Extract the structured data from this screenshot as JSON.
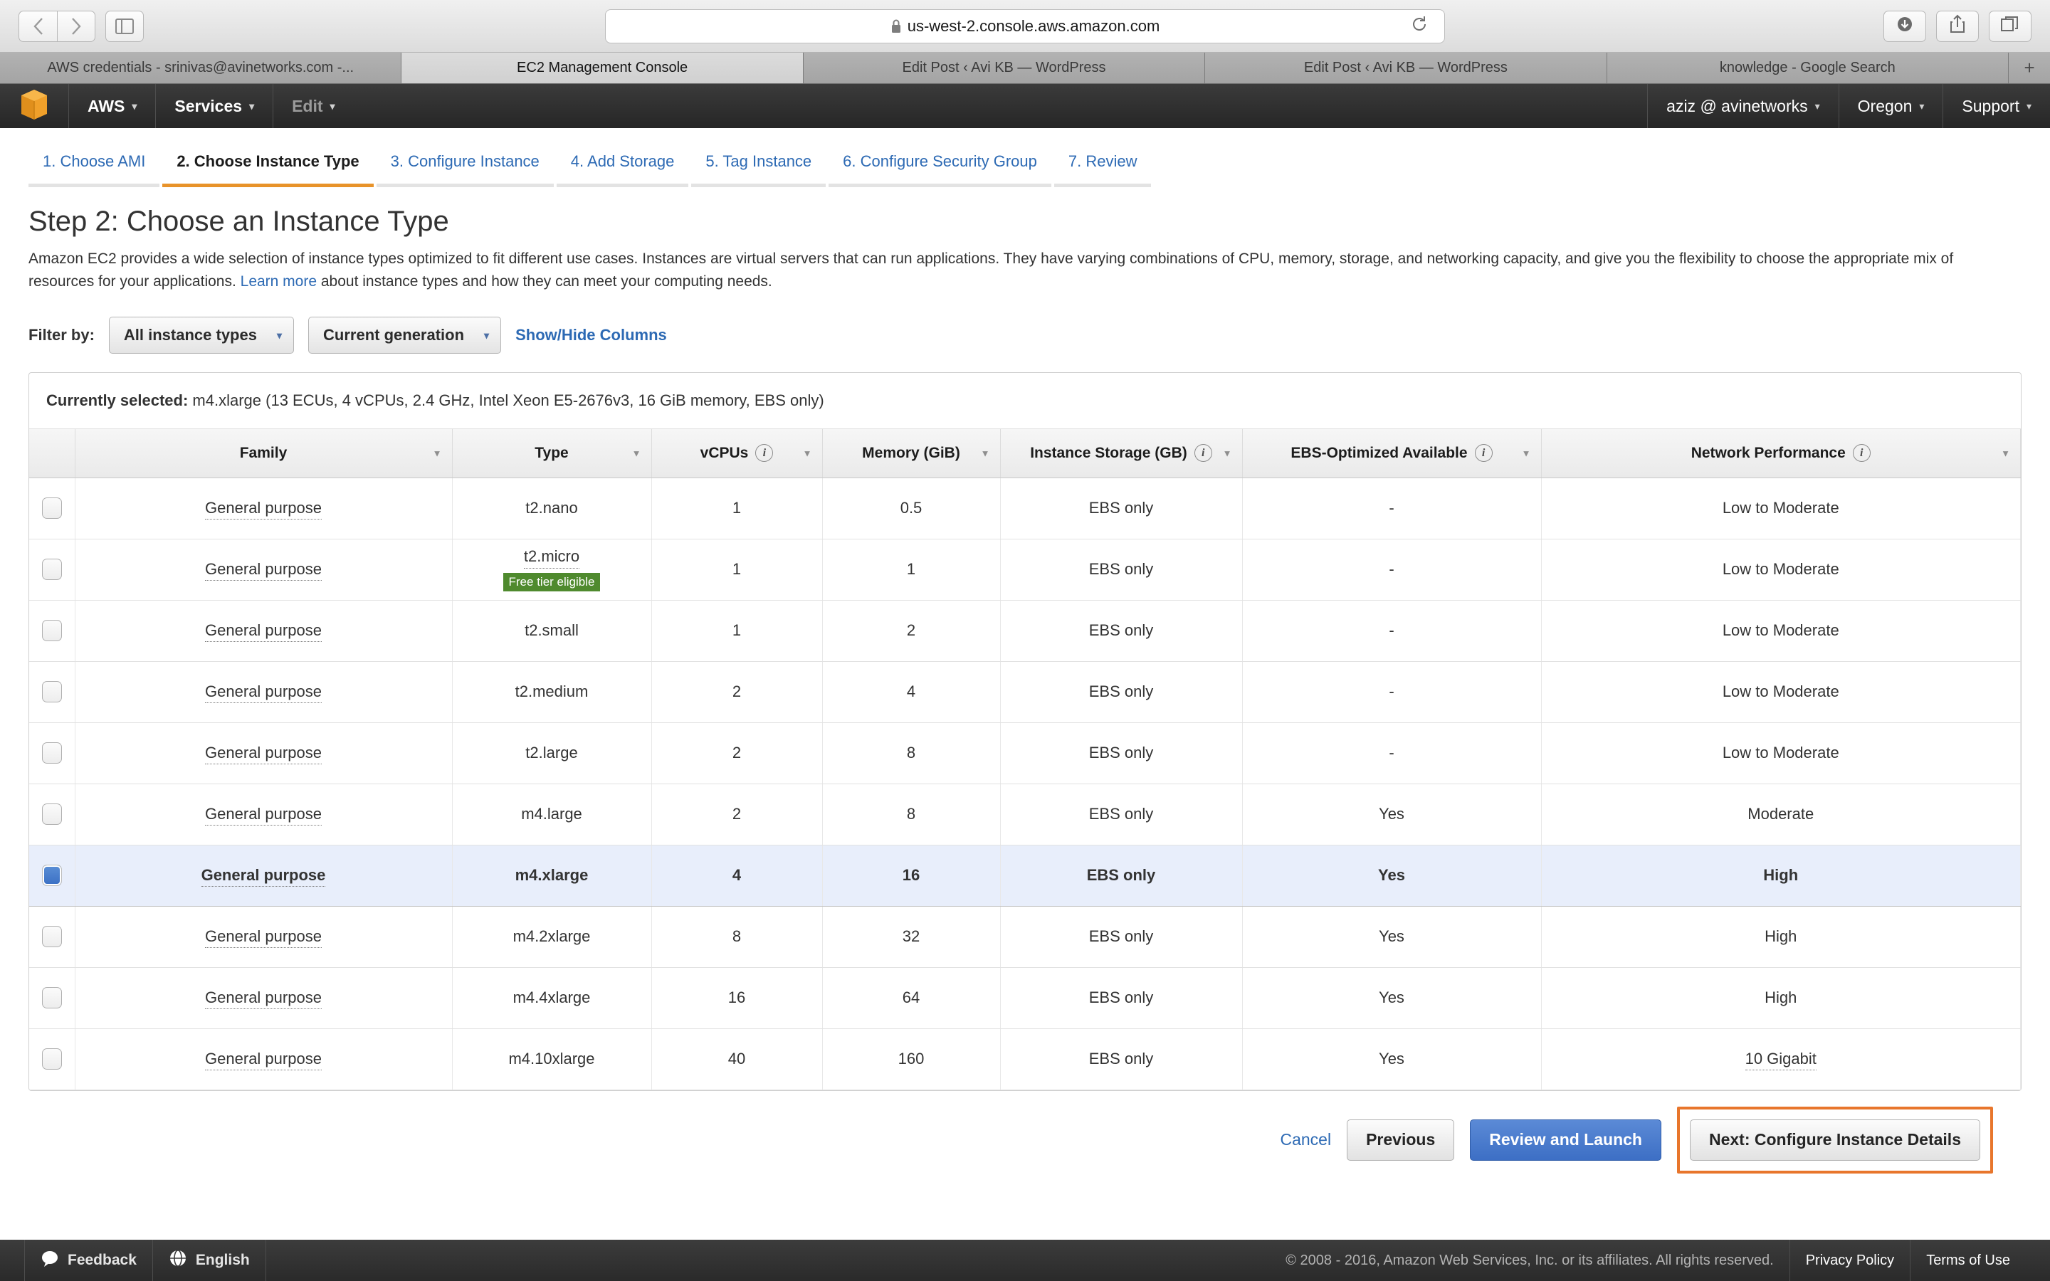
{
  "browser": {
    "url": "us-west-2.console.aws.amazon.com",
    "back_icon": "back-arrow-icon",
    "forward_icon": "forward-arrow-icon",
    "sidebar_icon": "sidebar-toggle-icon",
    "reload_icon": "reload-icon",
    "lock_icon": "lock-icon",
    "download_icon": "download-icon",
    "share_icon": "share-icon",
    "tabs_overview_icon": "tab-overview-icon",
    "new_tab_label": "+",
    "tabs": [
      {
        "label": "AWS credentials - srinivas@avinetworks.com -...",
        "active": false
      },
      {
        "label": "EC2 Management Console",
        "active": true
      },
      {
        "label": "Edit Post ‹ Avi KB — WordPress",
        "active": false
      },
      {
        "label": "Edit Post ‹ Avi KB — WordPress",
        "active": false
      },
      {
        "label": "knowledge - Google Search",
        "active": false
      }
    ]
  },
  "aws_nav": {
    "logo_icon": "aws-cube-logo-icon",
    "left_items": [
      {
        "label": "AWS",
        "caret": "▾",
        "dim": false
      },
      {
        "label": "Services",
        "caret": "▾",
        "dim": false
      },
      {
        "label": "Edit",
        "caret": "▾",
        "dim": true
      }
    ],
    "right_items": [
      {
        "label": "aziz @ avinetworks",
        "caret": "▾"
      },
      {
        "label": "Oregon",
        "caret": "▾"
      },
      {
        "label": "Support",
        "caret": "▾"
      }
    ]
  },
  "wizard": {
    "steps": [
      {
        "label": "1. Choose AMI",
        "active": false
      },
      {
        "label": "2. Choose Instance Type",
        "active": true
      },
      {
        "label": "3. Configure Instance",
        "active": false
      },
      {
        "label": "4. Add Storage",
        "active": false
      },
      {
        "label": "5. Tag Instance",
        "active": false
      },
      {
        "label": "6. Configure Security Group",
        "active": false
      },
      {
        "label": "7. Review",
        "active": false
      }
    ]
  },
  "page": {
    "title": "Step 2: Choose an Instance Type",
    "desc_part1": "Amazon EC2 provides a wide selection of instance types optimized to fit different use cases. Instances are virtual servers that can run applications. They have varying combinations of CPU, memory, storage, and networking capacity, and give you the flexibility to choose the appropriate mix of resources for your applications. ",
    "learn_more": "Learn more",
    "desc_part2": " about instance types and how they can meet your computing needs."
  },
  "filters": {
    "label": "Filter by:",
    "instance_types_value": "All instance types",
    "generation_value": "Current generation",
    "show_hide_columns": "Show/Hide Columns",
    "caret": "▾"
  },
  "selection": {
    "prefix": "Currently selected:",
    "value": "m4.xlarge (13 ECUs, 4 vCPUs, 2.4 GHz, Intel Xeon E5-2676v3, 16 GiB memory, EBS only)"
  },
  "table": {
    "columns": [
      {
        "label": "",
        "info": false,
        "sort": false
      },
      {
        "label": "Family",
        "info": false,
        "sort": true
      },
      {
        "label": "Type",
        "info": false,
        "sort": true
      },
      {
        "label": "vCPUs",
        "info": true,
        "sort": true
      },
      {
        "label": "Memory (GiB)",
        "info": false,
        "sort": true
      },
      {
        "label": "Instance Storage (GB)",
        "info": true,
        "sort": true
      },
      {
        "label": "EBS-Optimized Available",
        "info": true,
        "sort": true
      },
      {
        "label": "Network Performance",
        "info": true,
        "sort": true
      }
    ],
    "rows": [
      {
        "selected": false,
        "family": "General purpose",
        "type": "t2.nano",
        "badge": "",
        "vcpus": "1",
        "memory": "0.5",
        "storage": "EBS only",
        "ebs": "-",
        "network": "Low to Moderate"
      },
      {
        "selected": false,
        "family": "General purpose",
        "type": "t2.micro",
        "badge": "Free tier eligible",
        "vcpus": "1",
        "memory": "1",
        "storage": "EBS only",
        "ebs": "-",
        "network": "Low to Moderate"
      },
      {
        "selected": false,
        "family": "General purpose",
        "type": "t2.small",
        "badge": "",
        "vcpus": "1",
        "memory": "2",
        "storage": "EBS only",
        "ebs": "-",
        "network": "Low to Moderate"
      },
      {
        "selected": false,
        "family": "General purpose",
        "type": "t2.medium",
        "badge": "",
        "vcpus": "2",
        "memory": "4",
        "storage": "EBS only",
        "ebs": "-",
        "network": "Low to Moderate"
      },
      {
        "selected": false,
        "family": "General purpose",
        "type": "t2.large",
        "badge": "",
        "vcpus": "2",
        "memory": "8",
        "storage": "EBS only",
        "ebs": "-",
        "network": "Low to Moderate"
      },
      {
        "selected": false,
        "family": "General purpose",
        "type": "m4.large",
        "badge": "",
        "vcpus": "2",
        "memory": "8",
        "storage": "EBS only",
        "ebs": "Yes",
        "network": "Moderate"
      },
      {
        "selected": true,
        "family": "General purpose",
        "type": "m4.xlarge",
        "badge": "",
        "vcpus": "4",
        "memory": "16",
        "storage": "EBS only",
        "ebs": "Yes",
        "network": "High"
      },
      {
        "selected": false,
        "family": "General purpose",
        "type": "m4.2xlarge",
        "badge": "",
        "vcpus": "8",
        "memory": "32",
        "storage": "EBS only",
        "ebs": "Yes",
        "network": "High"
      },
      {
        "selected": false,
        "family": "General purpose",
        "type": "m4.4xlarge",
        "badge": "",
        "vcpus": "16",
        "memory": "64",
        "storage": "EBS only",
        "ebs": "Yes",
        "network": "High"
      },
      {
        "selected": false,
        "family": "General purpose",
        "type": "m4.10xlarge",
        "badge": "",
        "vcpus": "40",
        "memory": "160",
        "storage": "EBS only",
        "ebs": "Yes",
        "network": "10 Gigabit"
      }
    ]
  },
  "actions": {
    "cancel": "Cancel",
    "previous": "Previous",
    "review_and_launch": "Review and Launch",
    "next": "Next: Configure Instance Details",
    "highlight_color": "#e8762c"
  },
  "bottombar": {
    "feedback": "Feedback",
    "language": "English",
    "feedback_icon": "speech-bubble-icon",
    "globe_icon": "globe-icon",
    "copyright": "© 2008 - 2016, Amazon Web Services, Inc. or its affiliates. All rights reserved.",
    "privacy_policy": "Privacy Policy",
    "terms_of_use": "Terms of Use"
  },
  "colors": {
    "accent_orange": "#e8932a",
    "link_blue": "#2d6ab4",
    "primary_button": "#3d6fc5",
    "free_tier_green": "#4f8a2e",
    "selected_row": "#e8eefb"
  }
}
